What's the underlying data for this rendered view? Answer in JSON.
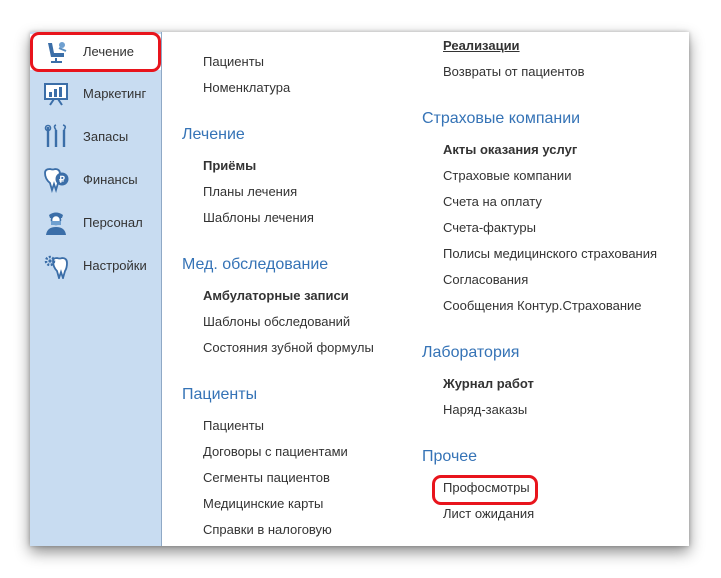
{
  "sidebar": {
    "items": [
      {
        "label": "Лечение",
        "icon": "dental-chair-icon",
        "active": true
      },
      {
        "label": "Маркетинг",
        "icon": "marketing-board-icon"
      },
      {
        "label": "Запасы",
        "icon": "dental-tools-icon"
      },
      {
        "label": "Финансы",
        "icon": "tooth-coin-icon"
      },
      {
        "label": "Персонал",
        "icon": "doctor-icon"
      },
      {
        "label": "Настройки",
        "icon": "tooth-gear-icon"
      }
    ]
  },
  "col1": {
    "top_links": [
      "Пациенты",
      "Номенклатура"
    ],
    "sections": [
      {
        "title": "Лечение",
        "items": [
          "Приёмы",
          "Планы лечения",
          "Шаблоны лечения"
        ]
      },
      {
        "title": "Мед. обследование",
        "items": [
          "Амбулаторные записи",
          "Шаблоны обследований",
          "Состояния зубной формулы"
        ]
      },
      {
        "title": "Пациенты",
        "items": [
          "Пациенты",
          "Договоры с пациентами",
          "Сегменты пациентов",
          "Медицинские карты",
          "Справки в налоговую"
        ]
      }
    ]
  },
  "col2": {
    "top_links": [
      "Реализации",
      "Возвраты от пациентов"
    ],
    "sections": [
      {
        "title": "Страховые компании",
        "items": [
          "Акты оказания услуг",
          "Страховые компании",
          "Счета на оплату",
          "Счета-фактуры",
          "Полисы медицинского страхования",
          "Согласования",
          "Сообщения Контур.Страхование"
        ]
      },
      {
        "title": "Лаборатория",
        "items": [
          "Журнал работ",
          "Наряд-заказы"
        ]
      },
      {
        "title": "Прочее",
        "items": [
          "Профосмотры",
          "Лист ожидания"
        ]
      }
    ]
  },
  "colors": {
    "section_title": "#3573b6",
    "sidebar_bg": "#c8dcf1",
    "highlight": "#e8141c"
  }
}
